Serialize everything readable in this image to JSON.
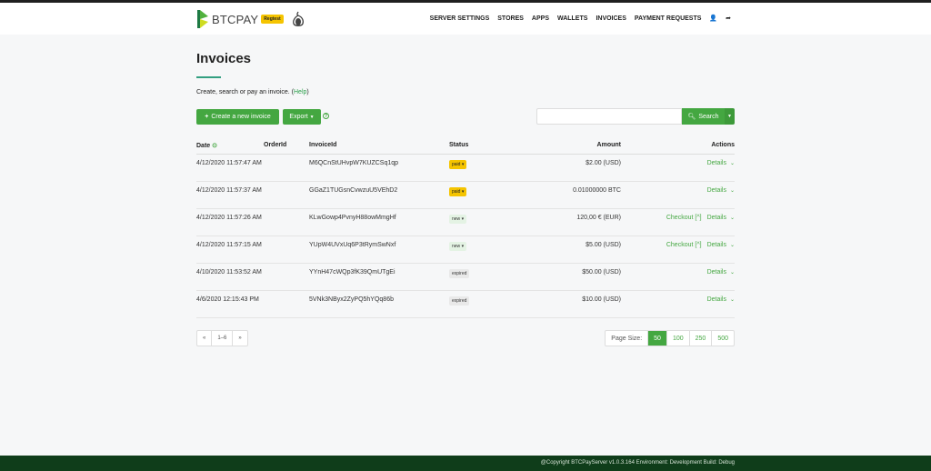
{
  "brand": {
    "name": "BTCPAY",
    "badge": "Regtest"
  },
  "nav": {
    "items": [
      "SERVER SETTINGS",
      "STORES",
      "APPS",
      "WALLETS",
      "INVOICES",
      "PAYMENT REQUESTS"
    ]
  },
  "page": {
    "title": "Invoices",
    "subtitle_text": "Create, search or pay an invoice. (",
    "subtitle_link": "Help",
    "subtitle_end": ")"
  },
  "toolbar": {
    "create_label": "Create a new invoice",
    "export_label": "Export",
    "search_label": "Search",
    "search_value": ""
  },
  "table": {
    "headers": {
      "date": "Date",
      "order": "OrderId",
      "invoice": "InvoiceId",
      "status": "Status",
      "amount": "Amount",
      "actions": "Actions"
    },
    "rows": [
      {
        "date": "4/12/2020 11:57:47 AM",
        "order": "",
        "invoice": "M6QCnStUHvpW7KUZCSq1qp",
        "status": "paid",
        "amount": "$2.00 (USD)",
        "checkout": "",
        "details": "Details"
      },
      {
        "date": "4/12/2020 11:57:37 AM",
        "order": "",
        "invoice": "GGaZ1TUGsnCvwzuU5VEhD2",
        "status": "paid",
        "amount": "0.01000000 BTC",
        "checkout": "",
        "details": "Details"
      },
      {
        "date": "4/12/2020 11:57:26 AM",
        "order": "",
        "invoice": "KLwGowp4PvnyH88owMmgHf",
        "status": "new",
        "amount": "120,00 € (EUR)",
        "checkout": "Checkout [^]",
        "details": "Details"
      },
      {
        "date": "4/12/2020 11:57:15 AM",
        "order": "",
        "invoice": "YUpW4UVxUq6P3tRymSwNxf",
        "status": "new",
        "amount": "$5.00 (USD)",
        "checkout": "Checkout [^]",
        "details": "Details"
      },
      {
        "date": "4/10/2020 11:53:52 AM",
        "order": "",
        "invoice": "YYnH47cWQp3fK39QmUTgEi",
        "status": "expired",
        "amount": "$50.00 (USD)",
        "checkout": "",
        "details": "Details"
      },
      {
        "date": "4/6/2020 12:15:43 PM",
        "order": "",
        "invoice": "5VNk3NByx2ZyPQ5hYQq86b",
        "status": "expired",
        "amount": "$10.00 (USD)",
        "checkout": "",
        "details": "Details"
      }
    ]
  },
  "pager": {
    "prev": "«",
    "range": "1–6",
    "next": "»"
  },
  "pagesize": {
    "label": "Page Size:",
    "options": [
      "50",
      "100",
      "250",
      "500"
    ],
    "active": "50"
  },
  "footer": {
    "text": "@Copyright BTCPayServer v1.0.3.164 Environment: Development Build: Debug"
  },
  "colors": {
    "accent": "#44a741",
    "footer": "#0f3d1a",
    "badge": "#f5c400"
  }
}
